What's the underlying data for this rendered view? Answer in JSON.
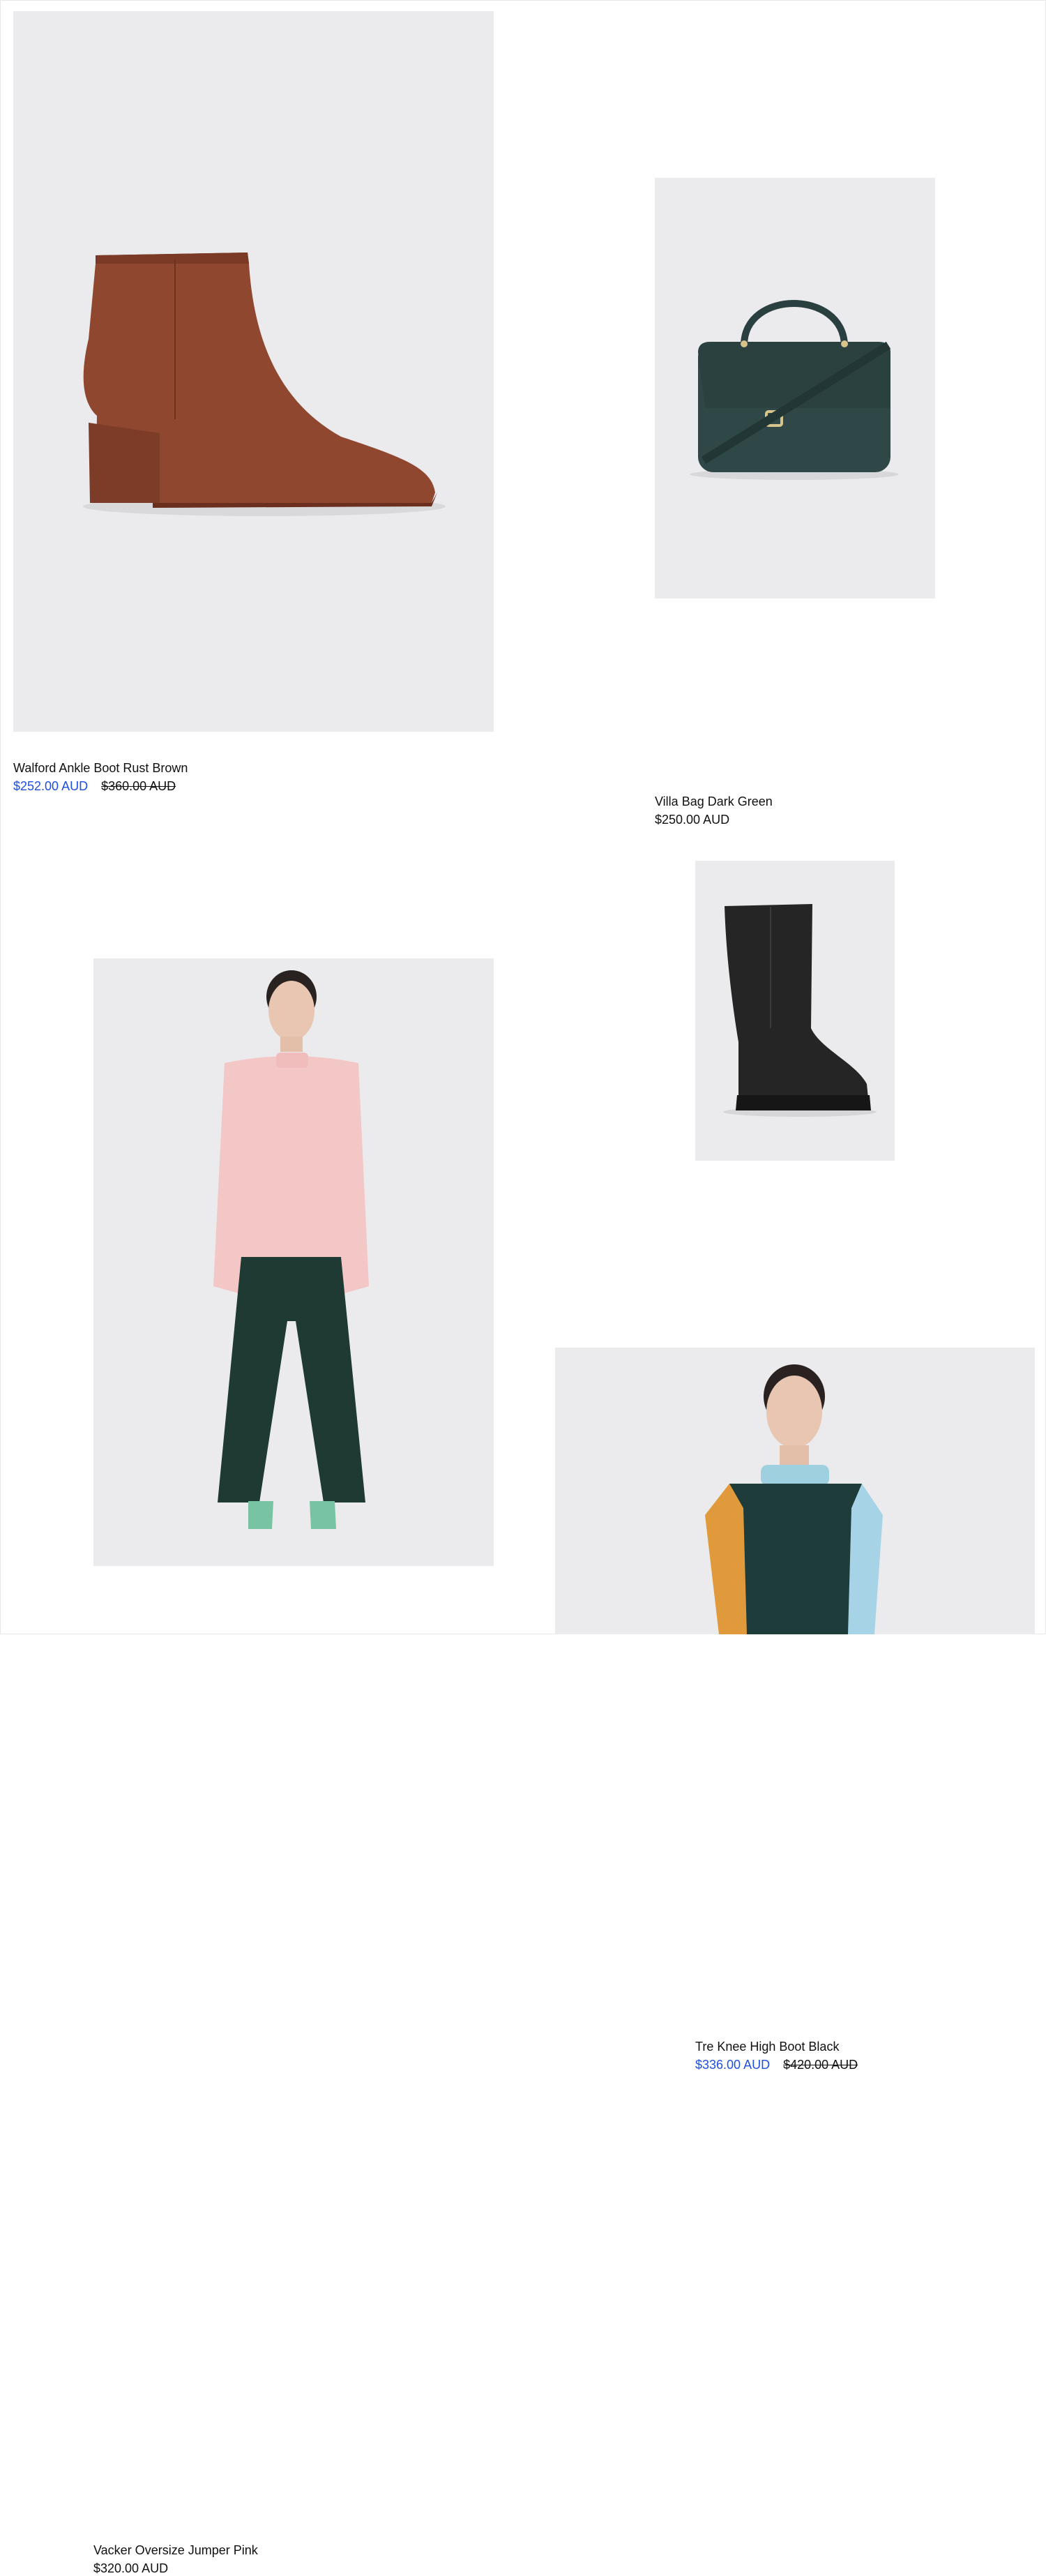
{
  "colors": {
    "sale_price": "#1f4fe0",
    "text": "#111111",
    "image_background": "#ebebed",
    "page_background": "#ffffff"
  },
  "products": [
    {
      "title": "Walford Ankle Boot Rust Brown",
      "price": "$252.00 AUD",
      "compare_at_price": "$360.00 AUD",
      "on_sale": true,
      "image_subject": "ankle-boot-rust-brown"
    },
    {
      "title": "Villa Bag Dark Green",
      "price": "$250.00 AUD",
      "on_sale": false,
      "image_subject": "handbag-dark-green"
    },
    {
      "title": "Tre Knee High Boot Black",
      "price": "$336.00 AUD",
      "compare_at_price": "$420.00 AUD",
      "on_sale": true,
      "image_subject": "knee-high-boot-black"
    },
    {
      "title": "Vacker Oversize Jumper Pink",
      "price": "$320.00 AUD",
      "on_sale": false,
      "image_subject": "model-pink-jumper"
    },
    {
      "image_subject": "model-colorblock-jumper"
    }
  ]
}
